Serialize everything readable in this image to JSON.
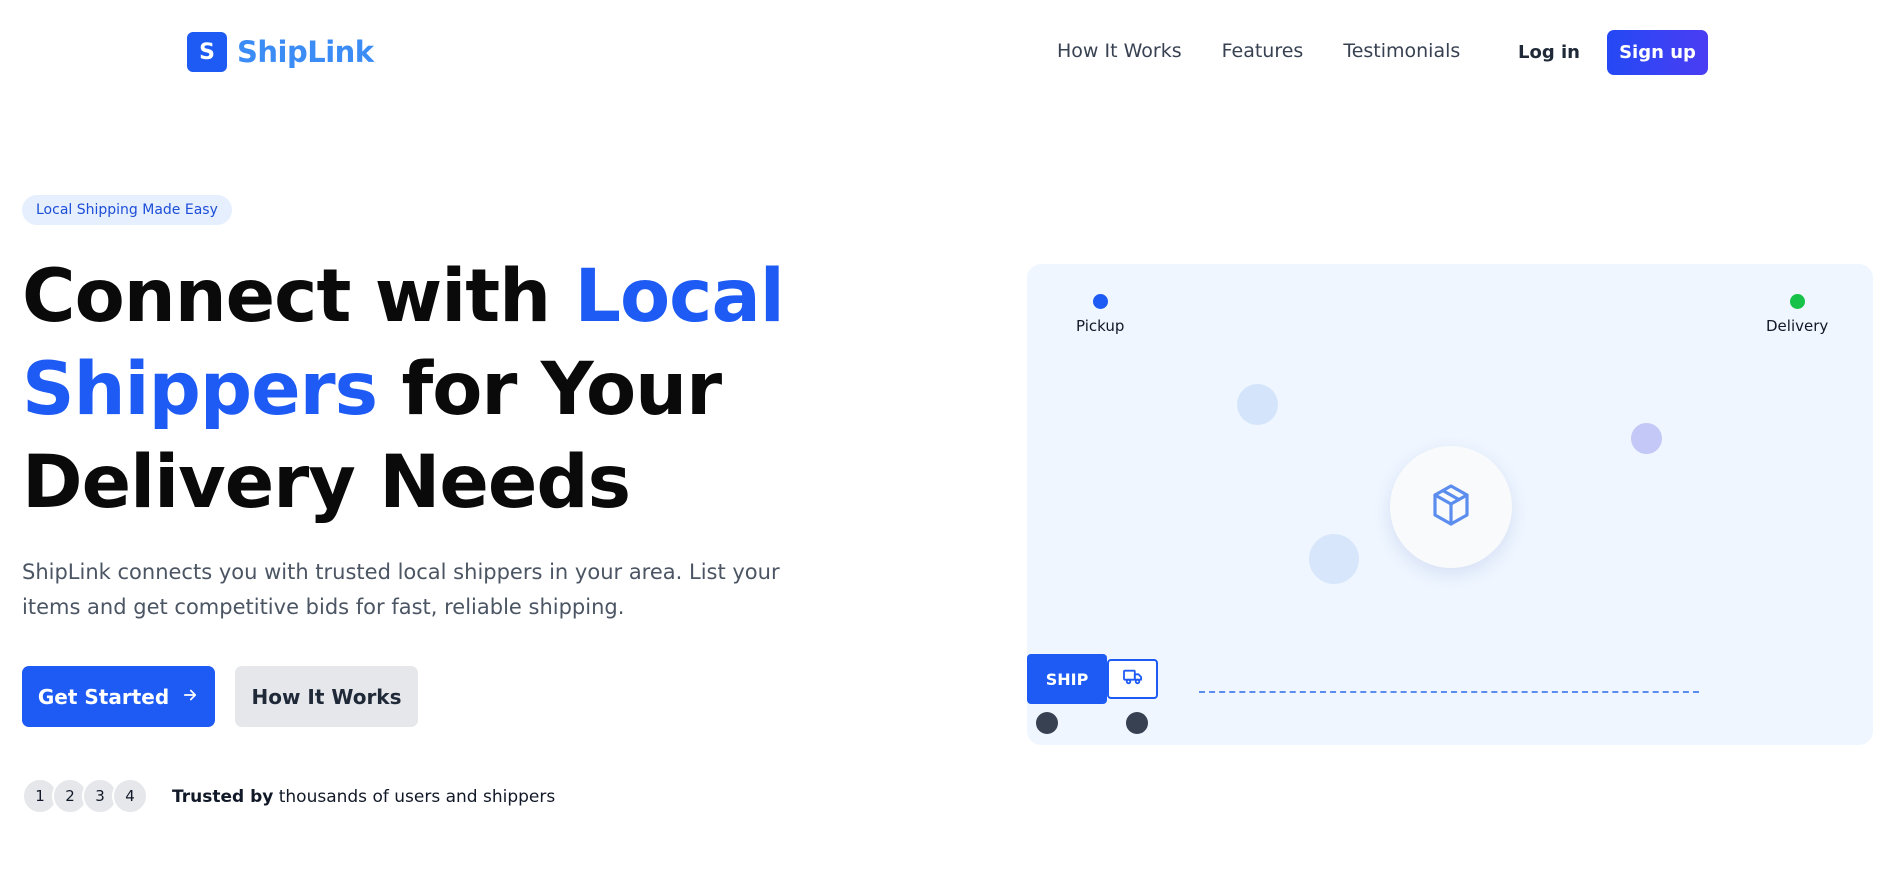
{
  "brand": {
    "mark": "S",
    "name": "ShipLink"
  },
  "nav": {
    "items": [
      "How It Works",
      "Features",
      "Testimonials"
    ],
    "login": "Log in",
    "signup": "Sign up"
  },
  "hero": {
    "badge": "Local Shipping Made Easy",
    "headline_part1": "Connect with ",
    "headline_accent": "Local Shippers",
    "headline_part2": " for Your Delivery Needs",
    "subtext": "ShipLink connects you with trusted local shippers in your area. List your items and get competitive bids for fast, reliable shipping.",
    "primary_button": "Get Started",
    "secondary_button": "How It Works",
    "avatars": [
      "1",
      "2",
      "3",
      "4"
    ],
    "trust_bold": "Trusted by",
    "trust_rest": " thousands of users and shippers"
  },
  "illustration": {
    "pickup_label": "Pickup",
    "delivery_label": "Delivery",
    "truck_label": "SHIP",
    "icons": [
      "package-icon",
      "truck-icon",
      "arrow-right-icon"
    ]
  },
  "colors": {
    "primary": "#1e5bf5",
    "accent_light": "#3b8cf5",
    "pickup": "#1e5bf5",
    "delivery": "#16c247",
    "panel": "#eff6ff"
  }
}
